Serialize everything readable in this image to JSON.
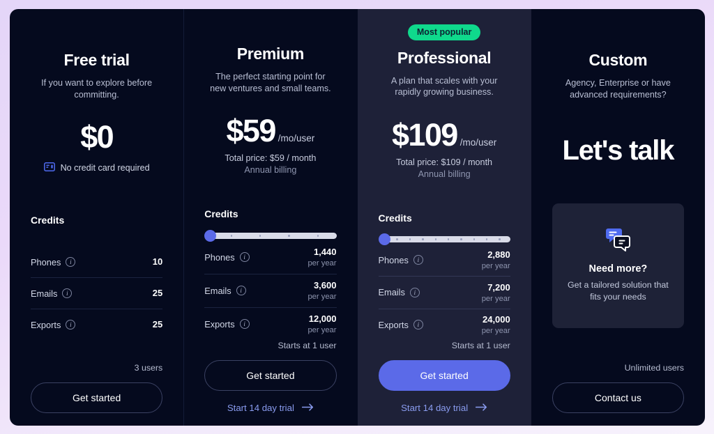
{
  "theme": {
    "page_background": "#e8daf9",
    "card_background": "#050a1e",
    "featured_background": "#1e2138",
    "accent_blue": "#5b6ae8",
    "accent_green": "#0fd98c",
    "link_blue": "#8a9cf0"
  },
  "plans": [
    {
      "badge": null,
      "name": "Free trial",
      "description": "If you want to explore before committing.",
      "price_amount": "$0",
      "price_unit": null,
      "price_total": null,
      "price_billing": null,
      "price_note": "No credit card required",
      "price_note_icon": "credit-card-icon",
      "headline": null,
      "credits_title": "Credits",
      "has_slider": false,
      "credits": [
        {
          "label": "Phones",
          "info_icon": "info-icon",
          "value": "10",
          "period": null
        },
        {
          "label": "Emails",
          "info_icon": "info-icon",
          "value": "25",
          "period": null
        },
        {
          "label": "Exports",
          "info_icon": "info-icon",
          "value": "25",
          "period": null
        }
      ],
      "users_note": "3 users",
      "cta_label": "Get started",
      "cta_style": "outline",
      "trial_link": null
    },
    {
      "badge": null,
      "name": "Premium",
      "description": "The perfect starting point for new ventures and small teams.",
      "price_amount": "$59",
      "price_unit": "/mo/user",
      "price_total": "Total price: $59 / month",
      "price_billing": "Annual billing",
      "price_note": null,
      "headline": null,
      "credits_title": "Credits",
      "has_slider": true,
      "slider_ticks": 4,
      "slider_position": 0,
      "credits": [
        {
          "label": "Phones",
          "info_icon": "info-icon",
          "value": "1,440",
          "period": "per year"
        },
        {
          "label": "Emails",
          "info_icon": "info-icon",
          "value": "3,600",
          "period": "per year"
        },
        {
          "label": "Exports",
          "info_icon": "info-icon",
          "value": "12,000",
          "period": "per year"
        }
      ],
      "users_note": "Starts at 1 user",
      "cta_label": "Get started",
      "cta_style": "outline",
      "trial_link": "Start 14 day trial"
    },
    {
      "badge": "Most popular",
      "name": "Professional",
      "description": "A plan that scales with your rapidly growing business.",
      "price_amount": "$109",
      "price_unit": "/mo/user",
      "price_total": "Total price: $109 / month",
      "price_billing": "Annual billing",
      "price_note": null,
      "headline": null,
      "credits_title": "Credits",
      "has_slider": true,
      "slider_ticks": 9,
      "slider_position": 0,
      "credits": [
        {
          "label": "Phones",
          "info_icon": "info-icon",
          "value": "2,880",
          "period": "per year"
        },
        {
          "label": "Emails",
          "info_icon": "info-icon",
          "value": "7,200",
          "period": "per year"
        },
        {
          "label": "Exports",
          "info_icon": "info-icon",
          "value": "24,000",
          "period": "per year"
        }
      ],
      "users_note": "Starts at 1 user",
      "cta_label": "Get started",
      "cta_style": "primary",
      "trial_link": "Start 14 day trial"
    },
    {
      "badge": null,
      "name": "Custom",
      "description": "Agency, Enterprise or have advanced requirements?",
      "price_amount": null,
      "headline": "Let's talk",
      "credits_title": null,
      "has_slider": false,
      "credits": [],
      "need_more": {
        "icon": "chat-bubbles-icon",
        "title": "Need more?",
        "text": "Get a tailored solution that fits your needs"
      },
      "users_note": "Unlimited users",
      "cta_label": "Contact us",
      "cta_style": "outline",
      "trial_link": null
    }
  ]
}
